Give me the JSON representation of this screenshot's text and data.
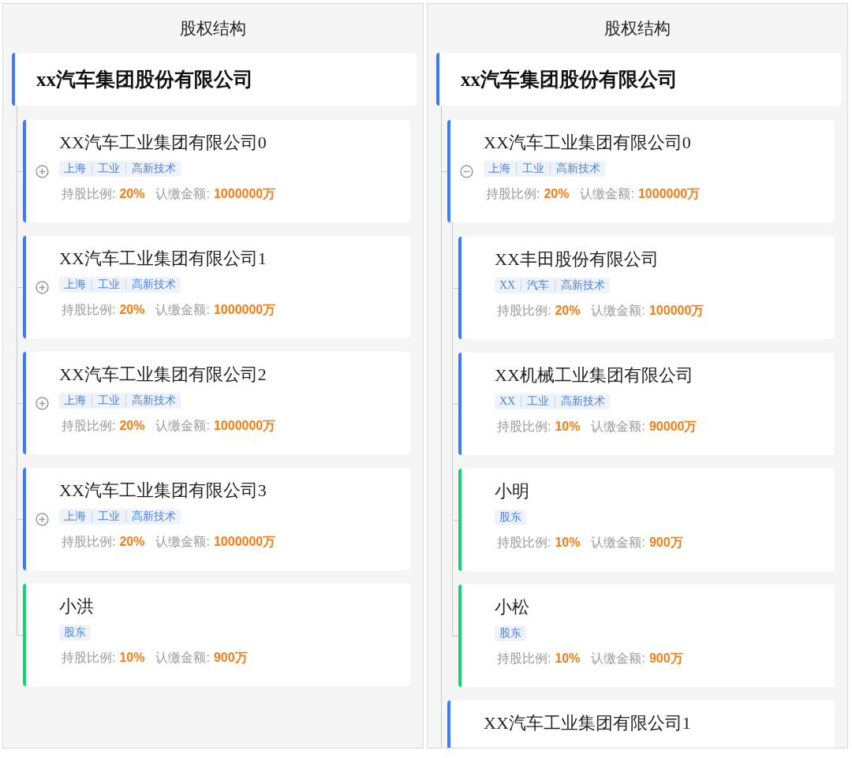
{
  "panels": [
    {
      "title": "股权结构",
      "root": {
        "name": "xx汽车集团股份有限公司",
        "children": [
          {
            "kind": "company",
            "name": "XX汽车工业集团有限公司0",
            "expanded": false,
            "tags": [
              "上海",
              "工业",
              "高新技术"
            ],
            "ratio_label": "持股比例:",
            "ratio": "20%",
            "amount_label": "认缴金额:",
            "amount": "1000000万"
          },
          {
            "kind": "company",
            "name": "XX汽车工业集团有限公司1",
            "expanded": false,
            "tags": [
              "上海",
              "工业",
              "高新技术"
            ],
            "ratio_label": "持股比例:",
            "ratio": "20%",
            "amount_label": "认缴金额:",
            "amount": "1000000万"
          },
          {
            "kind": "company",
            "name": "XX汽车工业集团有限公司2",
            "expanded": false,
            "tags": [
              "上海",
              "工业",
              "高新技术"
            ],
            "ratio_label": "持股比例:",
            "ratio": "20%",
            "amount_label": "认缴金额:",
            "amount": "1000000万"
          },
          {
            "kind": "company",
            "name": "XX汽车工业集团有限公司3",
            "expanded": false,
            "tags": [
              "上海",
              "工业",
              "高新技术"
            ],
            "ratio_label": "持股比例:",
            "ratio": "20%",
            "amount_label": "认缴金额:",
            "amount": "1000000万"
          },
          {
            "kind": "person",
            "name": "小洪",
            "tags": [
              "股东"
            ],
            "ratio_label": "持股比例:",
            "ratio": "10%",
            "amount_label": "认缴金额:",
            "amount": "900万"
          }
        ]
      }
    },
    {
      "title": "股权结构",
      "root": {
        "name": "xx汽车集团股份有限公司",
        "children": [
          {
            "kind": "company",
            "name": "XX汽车工业集团有限公司0",
            "expanded": true,
            "tags": [
              "上海",
              "工业",
              "高新技术"
            ],
            "ratio_label": "持股比例:",
            "ratio": "20%",
            "amount_label": "认缴金额:",
            "amount": "1000000万",
            "children": [
              {
                "kind": "company",
                "name": "XX丰田股份有限公司",
                "tags": [
                  "XX",
                  "汽车",
                  "高新技术"
                ],
                "ratio_label": "持股比例:",
                "ratio": "20%",
                "amount_label": "认缴金额:",
                "amount": "100000万"
              },
              {
                "kind": "company",
                "name": "XX机械工业集团有限公司",
                "tags": [
                  "XX",
                  "工业",
                  "高新技术"
                ],
                "ratio_label": "持股比例:",
                "ratio": "10%",
                "amount_label": "认缴金额:",
                "amount": "90000万"
              },
              {
                "kind": "person",
                "name": "小明",
                "tags": [
                  "股东"
                ],
                "ratio_label": "持股比例:",
                "ratio": "10%",
                "amount_label": "认缴金额:",
                "amount": "900万"
              },
              {
                "kind": "person",
                "name": "小松",
                "tags": [
                  "股东"
                ],
                "ratio_label": "持股比例:",
                "ratio": "10%",
                "amount_label": "认缴金额:",
                "amount": "900万"
              }
            ]
          },
          {
            "kind": "company",
            "name": "XX汽车工业集团有限公司1"
          }
        ]
      }
    }
  ]
}
